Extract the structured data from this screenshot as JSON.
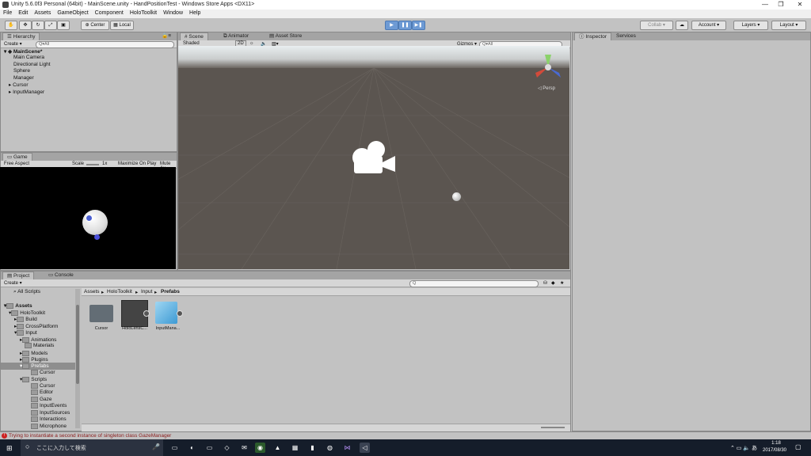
{
  "window": {
    "title": "Unity 5.6.0f3 Personal (64bit) - MainScene.unity - HandPositionTest - Windows Store Apps <DX11>",
    "minimize": "—",
    "maximize": "❐",
    "close": "✕"
  },
  "menu": [
    "File",
    "Edit",
    "Assets",
    "GameObject",
    "Component",
    "HoloToolkit",
    "Window",
    "Help"
  ],
  "toolbar": {
    "center": "Center",
    "local": "Local",
    "collab": "Collab ▾",
    "account": "Account",
    "layers": "Layers",
    "layout": "Layout"
  },
  "hierarchy": {
    "tab": "Hierarchy",
    "create": "Create ▾",
    "search_placeholder": "Q▾All",
    "scene": "MainScene*",
    "items": [
      "Main Camera",
      "Directional Light",
      "Sphere",
      "Manager",
      "Cursor",
      "InputManager"
    ]
  },
  "scene": {
    "tabs": [
      "Scene",
      "Animator",
      "Asset Store"
    ],
    "shaded": "Shaded",
    "mode2d": "2D",
    "gizmos": "Gizmos ▾",
    "search_placeholder": "Q▾All",
    "persp": "Persp"
  },
  "game": {
    "tab": "Game",
    "aspect": "Free Aspect",
    "scale_label": "Scale",
    "scale_value": "1x",
    "maximize": "Maximize On Play",
    "mute": "Mute Au"
  },
  "inspector": {
    "tabs": [
      "Inspector",
      "Services"
    ]
  },
  "project": {
    "tabs": [
      "Project",
      "Console"
    ],
    "create": "Create ▾",
    "favorites_item": "All Scripts",
    "root": "Assets",
    "tree": [
      "HoloToolkit",
      "Build",
      "CrossPlatform",
      "Input",
      "Animations",
      "Materials",
      "Models",
      "Plugins",
      "Prefabs",
      "Cursor",
      "Scripts",
      "Cursor",
      "Editor",
      "Gaze",
      "InputEvents",
      "InputSources",
      "Interactions",
      "Microphone"
    ],
    "breadcrumb": [
      "Assets",
      "HoloToolkit",
      "Input",
      "Prefabs"
    ],
    "assets": [
      "Cursor",
      "HoloLensC...",
      "InputMana..."
    ]
  },
  "status": {
    "message": "Trying to instantiate a second instance of singleton class GazeManager"
  },
  "taskbar": {
    "search_placeholder": "ここに入力して検索",
    "time": "1:18",
    "date": "2017/08/30"
  },
  "colors": {
    "scene_bg": "#5b5550",
    "sky": "#e7ecee",
    "play_blue": "#6d9ad4",
    "taskbar": "#151d2a",
    "error_red": "#cc2222"
  }
}
